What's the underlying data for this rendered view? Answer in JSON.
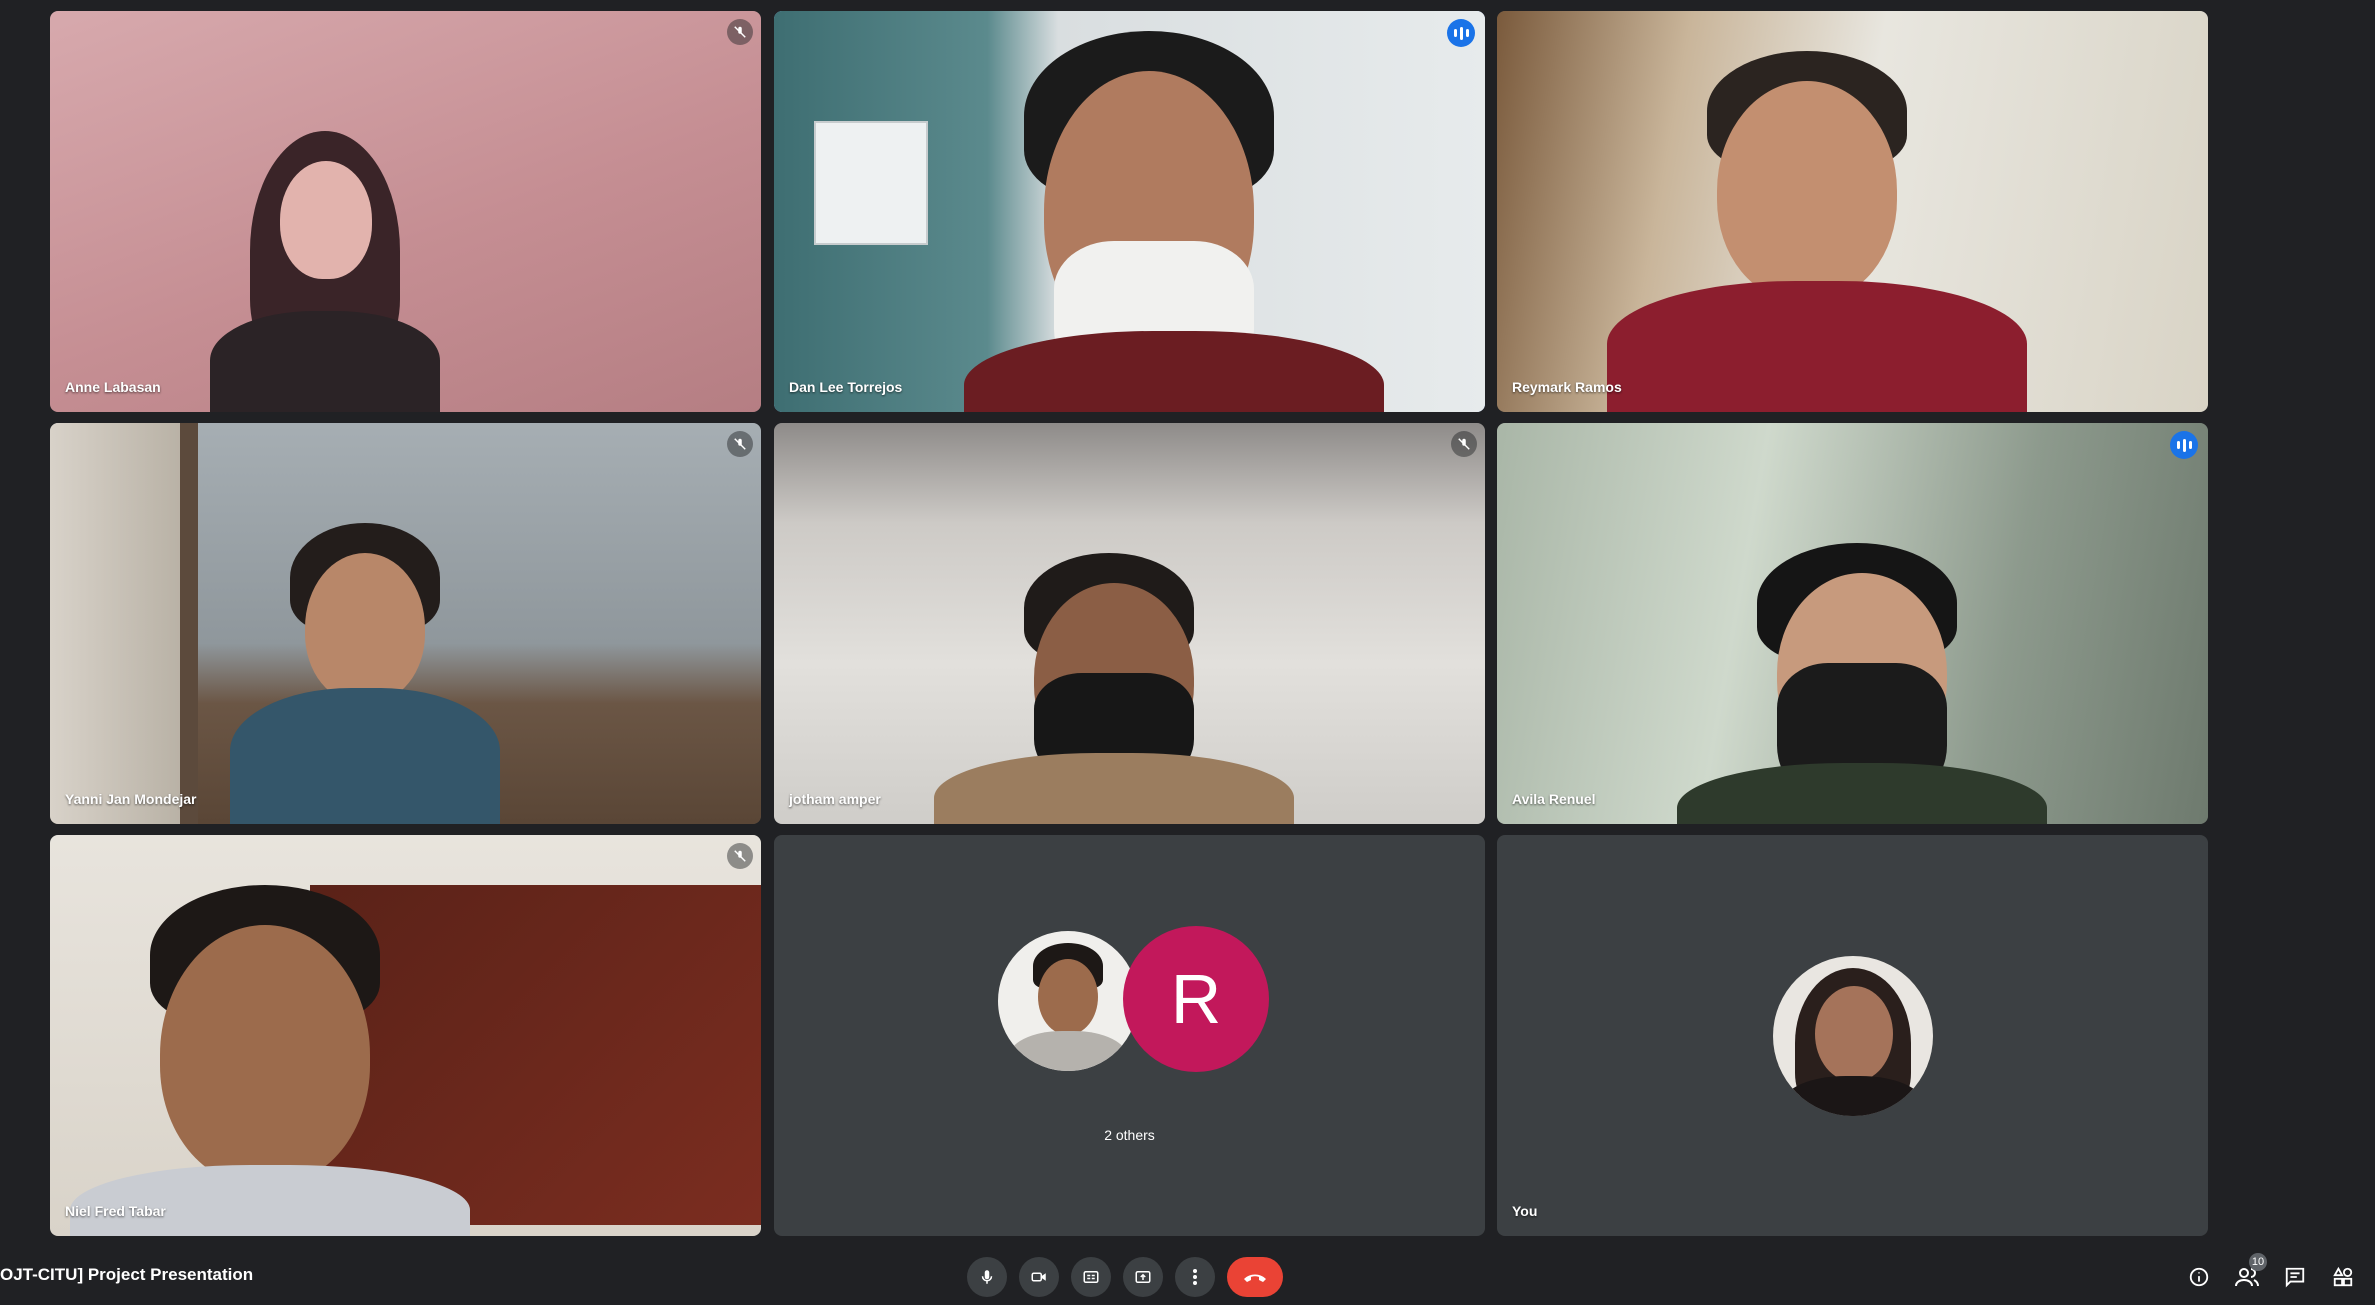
{
  "participants": [
    {
      "name": "Anne Labasan",
      "muted": true,
      "speaking": false
    },
    {
      "name": "Dan Lee Torrejos",
      "muted": false,
      "speaking": true
    },
    {
      "name": "Reymark Ramos",
      "muted": false,
      "speaking": false
    },
    {
      "name": "Yanni Jan Mondejar",
      "muted": true,
      "speaking": false
    },
    {
      "name": "jotham amper",
      "muted": true,
      "speaking": false
    },
    {
      "name": "Avila Renuel",
      "muted": false,
      "speaking": true
    },
    {
      "name": "Niel Fred Tabar",
      "muted": true,
      "speaking": false
    }
  ],
  "others": {
    "label": "2 others",
    "avatar_letter": "R",
    "avatar_color": "#c2185b"
  },
  "self": {
    "label": "You"
  },
  "meeting": {
    "title": "OJT-CITU] Project Presentation"
  },
  "controls": {
    "icons": [
      "microphone-icon",
      "camera-icon",
      "captions-icon",
      "present-icon",
      "more-options-icon",
      "end-call-icon"
    ]
  },
  "right_controls": {
    "people_count": "10",
    "icons": [
      "info-icon",
      "people-icon",
      "chat-icon",
      "activities-icon"
    ]
  },
  "colors": {
    "background": "#202124",
    "tile": "#3c4043",
    "accent": "#1a73e8",
    "end_call": "#ea4335"
  }
}
